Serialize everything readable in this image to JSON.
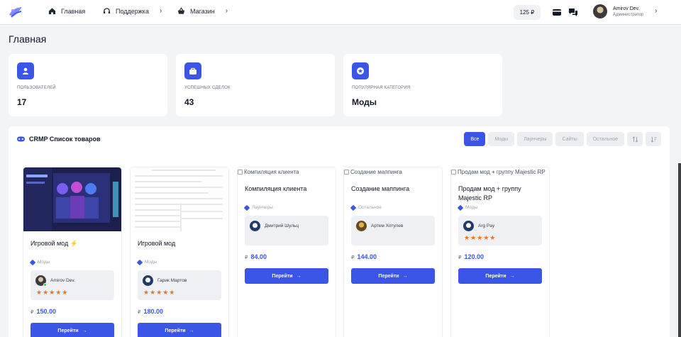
{
  "topbar": {
    "nav": [
      {
        "label": "Главная",
        "icon": "home-icon"
      },
      {
        "label": "Поддержка",
        "icon": "headset-icon"
      },
      {
        "label": "Магазин",
        "icon": "basket-icon"
      }
    ],
    "balance": "125 ₽",
    "user": {
      "name": "Amirov Dev.",
      "role": "Администратор"
    }
  },
  "page_title": "Главная",
  "stats": [
    {
      "label": "ПОЛЬЗОВАТЕЛЕЙ",
      "value": "17",
      "icon": "user-icon"
    },
    {
      "label": "УСПЕШНЫХ СДЕЛОК",
      "value": "43",
      "icon": "briefcase-icon"
    },
    {
      "label": "ПОПУЛЯРНАЯ КАТЕГОРИЯ",
      "value": "Моды",
      "icon": "star-icon"
    }
  ],
  "products_panel": {
    "title": "CRMP  Список товаров",
    "filters": [
      "Все",
      "Моды",
      "Лаунчеры",
      "Сайты",
      "Остальное"
    ]
  },
  "products": [
    {
      "title": "Игровой мод ⚡",
      "category": "Моды",
      "seller": "Amirov Dev.",
      "rating": 5,
      "price": "150.00",
      "currency": "₽",
      "button": "Перейти",
      "image_alt": ""
    },
    {
      "title": "Игровой мод",
      "category": "Моды",
      "seller": "Гарик Мартов",
      "rating": 5,
      "price": "180.00",
      "currency": "₽",
      "button": "Перейти",
      "image_alt": ""
    },
    {
      "title": "Компиляция клиента",
      "category": "Лаунчеры",
      "seller": "Дмитрий Шульц",
      "rating": 0,
      "price": "84.00",
      "currency": "₽",
      "button": "Перейти",
      "image_alt": "Компиляция клиента"
    },
    {
      "title": "Создание маппинга",
      "category": "Остальное",
      "seller": "Артем Хотулев",
      "rating": 0,
      "price": "144.00",
      "currency": "₽",
      "button": "Перейти",
      "image_alt": "Создание маппинга"
    },
    {
      "title": "Продам мод + группу Majestic RP",
      "category": "Моды",
      "seller": "Arg Pay",
      "rating": 5,
      "price": "120.00",
      "currency": "₽",
      "button": "Перейти",
      "image_alt": "Продам мод + группу Majestic RP"
    }
  ],
  "colors": {
    "accent": "#3b55e6",
    "star": "#f97316",
    "online": "#22c55e"
  }
}
